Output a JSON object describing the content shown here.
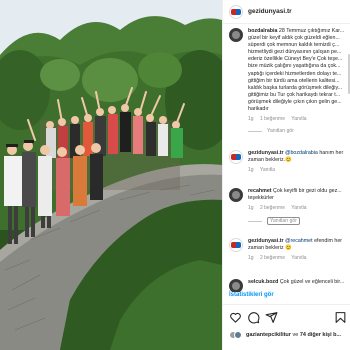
{
  "post": {
    "account": "gezidunyasi.tr"
  },
  "comments": [
    {
      "username": "bozdalrabia",
      "text": "28 Temmuz çıktığımız Kar... güzel bir keyif aldık çok güzeldi eğlen... süperdi çok memnun kaldık temizdi ç... hizmetliydi gezi dünyasının çalışan pe... ederiz özellikle Cüneyt Bey'e Çok teşe... bize müzik çalığını yaşattığına da çok... yaptığı içerdeki hizmetlerden dolayı te... gittiğim bir türdü ama otellerin kalitesi... kaldık başka turlarda görüşmek dileğiy... gittiğimiz bu Tur çok harikaydı tekrar t... görüşmek dileğiyle çıkın çıkın gelin ge... harikadır",
      "time": "1g",
      "likes": "1 beğenme",
      "reply": "Yanıtla",
      "replies_label": "Yanıtları gör"
    },
    {
      "username": "gezidunyasi.tr",
      "mention": "@bozdalrabia",
      "text": "hanım her zaman bekleriz.😊",
      "time": "1g",
      "reply": "Yanıtla"
    },
    {
      "username": "recahmet",
      "text": "Çok keyifli bir gezi oldu gez... teşekkürler",
      "time": "1g",
      "likes": "2 beğenme",
      "reply": "Yanıtla",
      "replies_label": "Yanıtları gör"
    },
    {
      "username": "gezidunyasi.tr",
      "mention": "@recahmet",
      "text": "efendim her zaman bekleriz 😊",
      "time": "1g",
      "likes": "2 beğenme",
      "reply": "Yanıtla"
    },
    {
      "username": "selcuk.bozd",
      "text": "Çok güzel ve eğlenceli bir..."
    }
  ],
  "insights_label": "İstatistikleri gör",
  "likes_summary": {
    "user": "gaziantepcikilitur",
    "connector": "ve",
    "others": "74 diğer kişi b..."
  },
  "icons": [
    "heart-icon",
    "comment-icon",
    "share-icon",
    "bookmark-icon"
  ],
  "colors": {
    "link": "#0095f6",
    "mention": "#00376b",
    "muted": "#8e8e8e"
  }
}
